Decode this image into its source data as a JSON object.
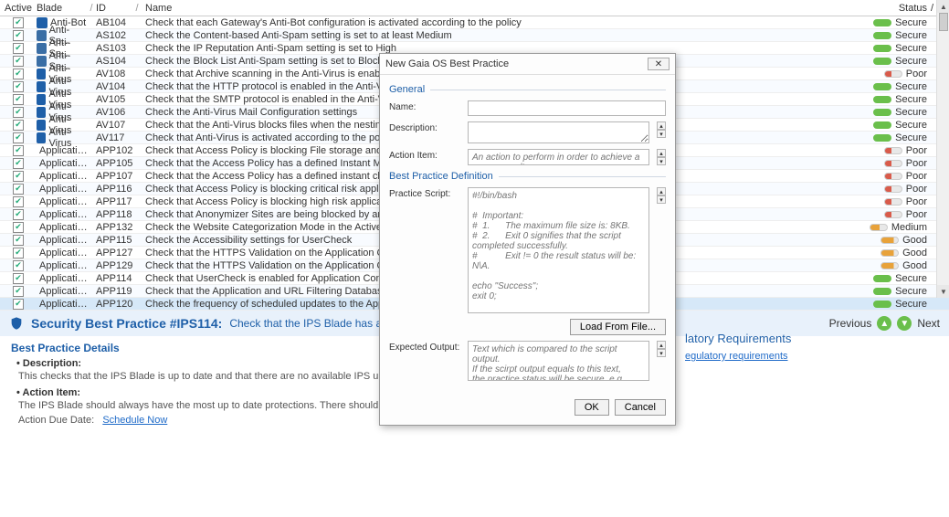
{
  "columns": {
    "active": "Active",
    "blade": "Blade",
    "id": "ID",
    "name": "Name",
    "status": "Status"
  },
  "rows": [
    {
      "blade": "Anti-Bot",
      "ico": "antibot",
      "id": "AB104",
      "name": "Check that each Gateway's Anti-Bot configuration is activated according to the policy",
      "status": "Secure",
      "pill": "secure"
    },
    {
      "blade": "Anti-Sp…",
      "ico": "antispam",
      "id": "AS102",
      "name": "Check the Content-based Anti-Spam setting is set to at least Medium",
      "status": "Secure",
      "pill": "secure"
    },
    {
      "blade": "Anti-Sp…",
      "ico": "antispam",
      "id": "AS103",
      "name": "Check the IP Reputation Anti-Spam setting is set to High",
      "status": "Secure",
      "pill": "secure"
    },
    {
      "blade": "Anti-Sp…",
      "ico": "antispam",
      "id": "AS104",
      "name": "Check the Block List Anti-Spam setting is set to Block",
      "status": "Secure",
      "pill": "secure"
    },
    {
      "blade": "Anti-Virus",
      "ico": "antivirus",
      "id": "AV108",
      "name": "Check that Archive scanning in the Anti-Virus is enabled",
      "status": "Poor",
      "pill": "poor"
    },
    {
      "blade": "Anti-Virus",
      "ico": "antivirus",
      "id": "AV104",
      "name": "Check that the HTTP protocol is enabled in the Anti-Virus settings",
      "status": "Secure",
      "pill": "secure"
    },
    {
      "blade": "Anti-Virus",
      "ico": "antivirus",
      "id": "AV105",
      "name": "Check that the SMTP protocol is enabled in the Anti-Virus settings",
      "status": "Secure",
      "pill": "secure"
    },
    {
      "blade": "Anti-Virus",
      "ico": "antivirus",
      "id": "AV106",
      "name": "Check the Anti-Virus Mail Configuration settings",
      "status": "Secure",
      "pill": "secure"
    },
    {
      "blade": "Anti-Virus",
      "ico": "antivirus",
      "id": "AV107",
      "name": "Check that the Anti-Virus blocks files when the nesting level is exceeded",
      "status": "Secure",
      "pill": "secure"
    },
    {
      "blade": "Anti-Virus",
      "ico": "antivirus",
      "id": "AV117",
      "name": "Check that Anti-Virus is activated according to the policy",
      "status": "Secure",
      "pill": "secure"
    },
    {
      "blade": "Applicati…",
      "ico": "app",
      "id": "APP102",
      "name": "Check that Access Policy is blocking File storage and sharing applications and sites",
      "status": "Poor",
      "pill": "poor"
    },
    {
      "blade": "Applicati…",
      "ico": "app",
      "id": "APP105",
      "name": "Check that the Access Policy has a defined Instant Messaging policy",
      "status": "Poor",
      "pill": "poor"
    },
    {
      "blade": "Applicati…",
      "ico": "app",
      "id": "APP107",
      "name": "Check that the Access Policy has a defined instant chat policy",
      "status": "Poor",
      "pill": "poor"
    },
    {
      "blade": "Applicati…",
      "ico": "app",
      "id": "APP116",
      "name": "Check that Access Policy is blocking critical risk applications and sites",
      "status": "Poor",
      "pill": "poor"
    },
    {
      "blade": "Applicati…",
      "ico": "app",
      "id": "APP117",
      "name": "Check that Access Policy is blocking high risk applications and sites",
      "status": "Poor",
      "pill": "poor"
    },
    {
      "blade": "Applicati…",
      "ico": "app",
      "id": "APP118",
      "name": "Check that Anonymizer Sites are being blocked by an Access Policy",
      "status": "Poor",
      "pill": "poor"
    },
    {
      "blade": "Applicati…",
      "ico": "app",
      "id": "APP132",
      "name": "Check the  Website Categorization Mode in the Active Blade setting",
      "status": "Medium",
      "pill": "medium"
    },
    {
      "blade": "Applicati…",
      "ico": "app",
      "id": "APP115",
      "name": "Check the Accessibility settings for UserCheck",
      "status": "Good",
      "pill": "good"
    },
    {
      "blade": "Applicati…",
      "ico": "app",
      "id": "APP127",
      "name": "Check that the HTTPS Validation on the Application Control blade drops traffic from",
      "status": "Good",
      "pill": "good"
    },
    {
      "blade": "Applicati…",
      "ico": "app",
      "id": "APP129",
      "name": "Check that the HTTPS Validation on the Application Control blade drops traffic from",
      "status": "Good",
      "pill": "good"
    },
    {
      "blade": "Applicati…",
      "ico": "app",
      "id": "APP114",
      "name": "Check that UserCheck is enabled for Application Control",
      "status": "Secure",
      "pill": "secure"
    },
    {
      "blade": "Applicati…",
      "ico": "app",
      "id": "APP119",
      "name": "Check that the Application and URL Filtering Database is automatically updated",
      "status": "Secure",
      "pill": "secure"
    },
    {
      "blade": "Applicati…",
      "ico": "app",
      "id": "APP120",
      "name": "Check the frequency of scheduled updates to the Application and URL Filtering data",
      "status": "Secure",
      "pill": "secure",
      "sel": true
    }
  ],
  "banner": {
    "title": "Security Best Practice #IPS114:",
    "sub": "Check that the IPS Blade has an update",
    "prev": "Previous",
    "next": "Next"
  },
  "details": {
    "heading": "Best Practice Details",
    "desc_label": "Description:",
    "desc_text": "This checks that the IPS Blade is up to date and that there are no available IPS updates older than eight days that h",
    "action_label": "Action Item:",
    "action_text": "The IPS Blade should always have the most up to date protections. There shouldn't be an available IPS update that",
    "due_label": "Action Due Date:",
    "due_link": "Schedule Now"
  },
  "req": {
    "heading": "latory Requirements",
    "sub": "egulatory requirements"
  },
  "dialog": {
    "title": "New Gaia OS Best Practice",
    "general": "General",
    "name_lab": "Name:",
    "desc_lab": "Description:",
    "action_lab": "Action Item:",
    "action_ph": "An action to perform in order to achieve a secure result.",
    "bpdef": "Best Practice Definition",
    "script_lab": "Practice Script:",
    "script_ph": "#!/bin/bash\n\n#  Important:\n#  1.      The maximum file size is: 8KB.\n#  2.      Exit 0 signifies that the script completed successfully.\n#           Exit != 0 the result status will be: N\\A.\n\necho \"Success\";\nexit 0;",
    "load": "Load From File...",
    "expected_lab": "Expected Output:",
    "expected_ph": "Text which is compared to the script output.\nIf the scirpt output equals to this text,\nthe practice status will be secure. e.g. \"Success\".",
    "ok": "OK",
    "cancel": "Cancel"
  }
}
